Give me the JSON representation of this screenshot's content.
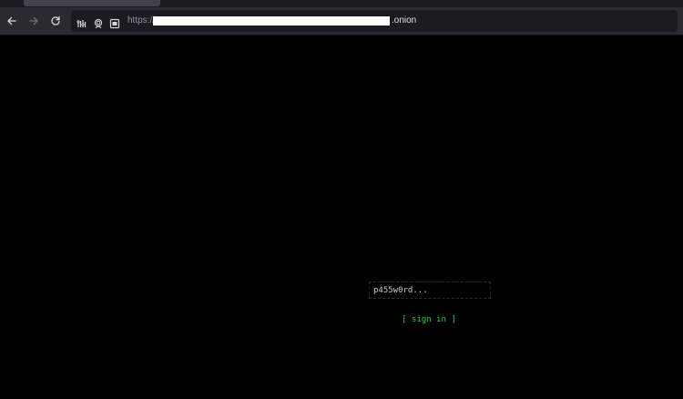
{
  "browser": {
    "url_prefix": "https://",
    "url_suffix": ".onion",
    "icons": {
      "back": "arrow-left-icon",
      "forward": "arrow-right-icon",
      "reload": "reload-icon",
      "permissions": "permissions-icon",
      "tor_circuit": "onion-circuit-icon",
      "reader": "reader-view-icon"
    }
  },
  "login": {
    "password_placeholder": "p455w0rd...",
    "signin_label": "[ sign in ]"
  },
  "colors": {
    "page_background": "#000000",
    "accent_green": "#2ecc40",
    "toolbar": "#2b2a33",
    "urlbar": "#1c1b22"
  }
}
